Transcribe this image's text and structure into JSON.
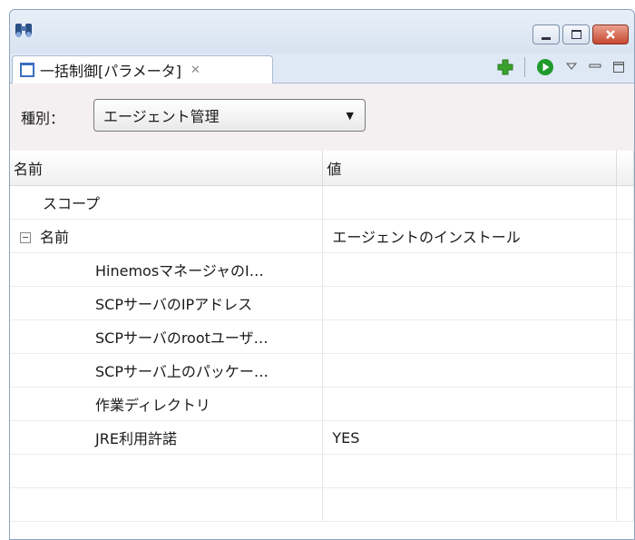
{
  "tab": {
    "title": "一括制御[パラメータ]"
  },
  "filter": {
    "label": "種別：",
    "value": "エージェント管理"
  },
  "table": {
    "columns": [
      "名前",
      "値"
    ],
    "rows": [
      {
        "name": "スコープ",
        "value": ""
      },
      {
        "name": "名前",
        "value": "エージェントのインストール"
      },
      {
        "name": "HinemosマネージャのI…",
        "value": ""
      },
      {
        "name": "SCPサーバのIPアドレス",
        "value": ""
      },
      {
        "name": "SCPサーバのrootユーザ…",
        "value": ""
      },
      {
        "name": "SCPサーバ上のパッケー…",
        "value": ""
      },
      {
        "name": "作業ディレクトリ",
        "value": ""
      },
      {
        "name": "JRE利用許諾",
        "value": "YES"
      },
      {
        "name": "",
        "value": ""
      },
      {
        "name": "",
        "value": ""
      }
    ]
  },
  "icons": {
    "app": "binoculars-icon",
    "add": "add-icon",
    "run": "run-icon",
    "view_menu": "view-menu-icon",
    "minimize_view": "minimize-view-icon",
    "maximize_view": "maximize-view-icon"
  },
  "colors": {
    "add": "#3aa22c",
    "run": "#1f9a2c",
    "close": "#c7472f"
  }
}
